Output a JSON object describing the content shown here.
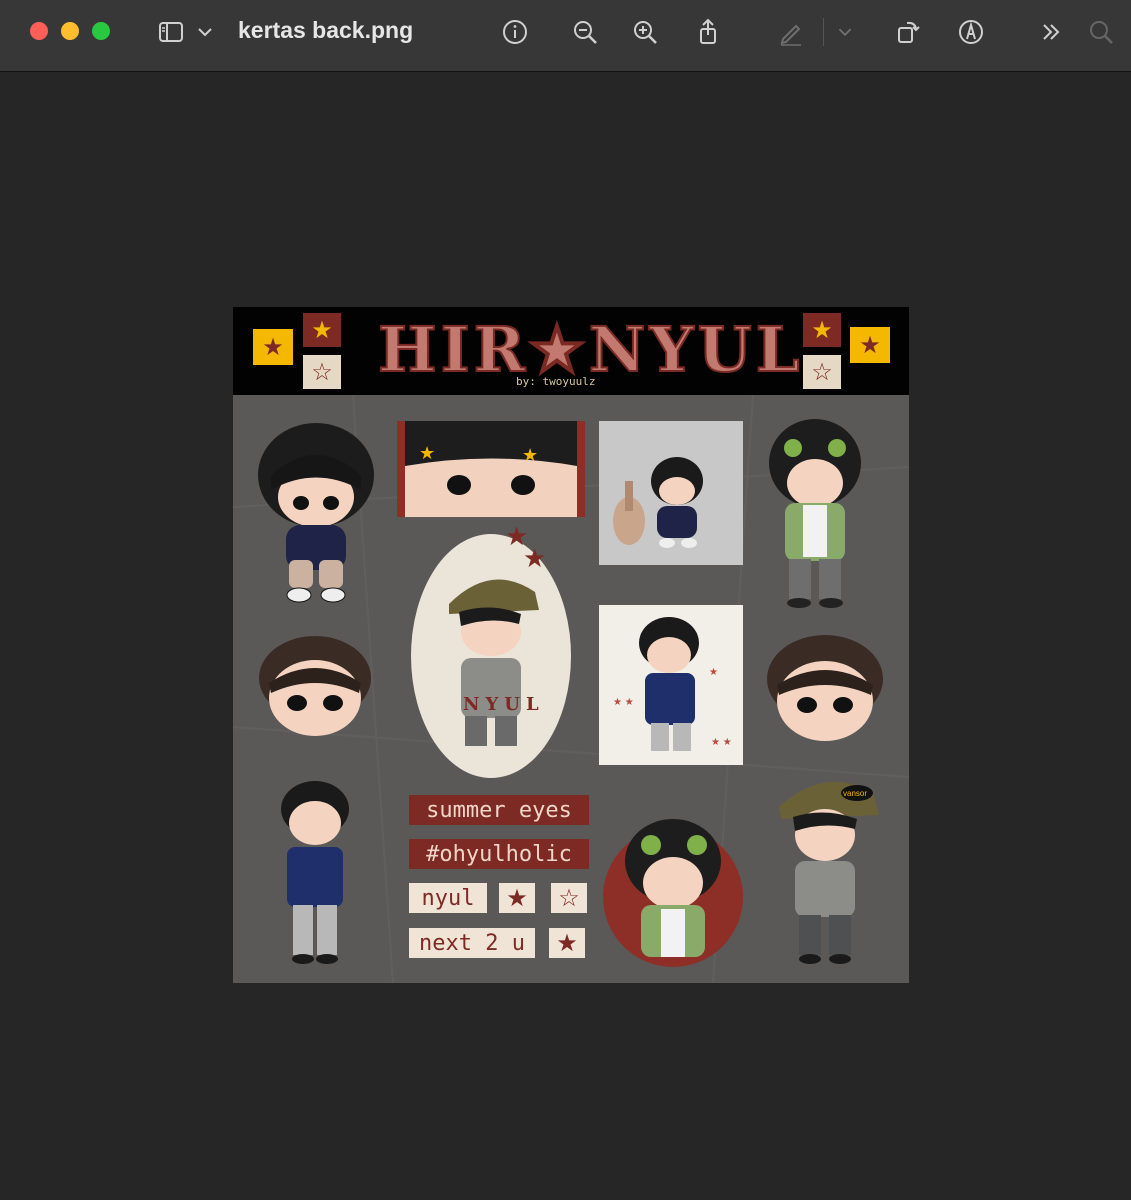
{
  "window": {
    "title": "kertas back.png"
  },
  "toolbar": {
    "icons": [
      "sidebar-icon",
      "chevron-down-icon",
      "info-icon",
      "zoom-out-icon",
      "zoom-in-icon",
      "share-icon",
      "markup-pen-icon",
      "chevron-down-icon",
      "rotate-icon",
      "annotate-icon",
      "more-icon",
      "search-icon"
    ]
  },
  "sheet": {
    "logo": "HIR★NYUL",
    "byline": "by: twoyuulz",
    "labels": {
      "summer": "summer eyes",
      "hashtag": "#ohyulholic",
      "nyul": "nyul",
      "next": "next 2 u",
      "cap_name": "NYUL",
      "cap_brand": "vansor"
    },
    "star_filled": "★",
    "star_outline": "☆"
  },
  "colors": {
    "brand_red": "#7e2a24",
    "cream": "#efe4d6",
    "gold": "#f5b800"
  }
}
